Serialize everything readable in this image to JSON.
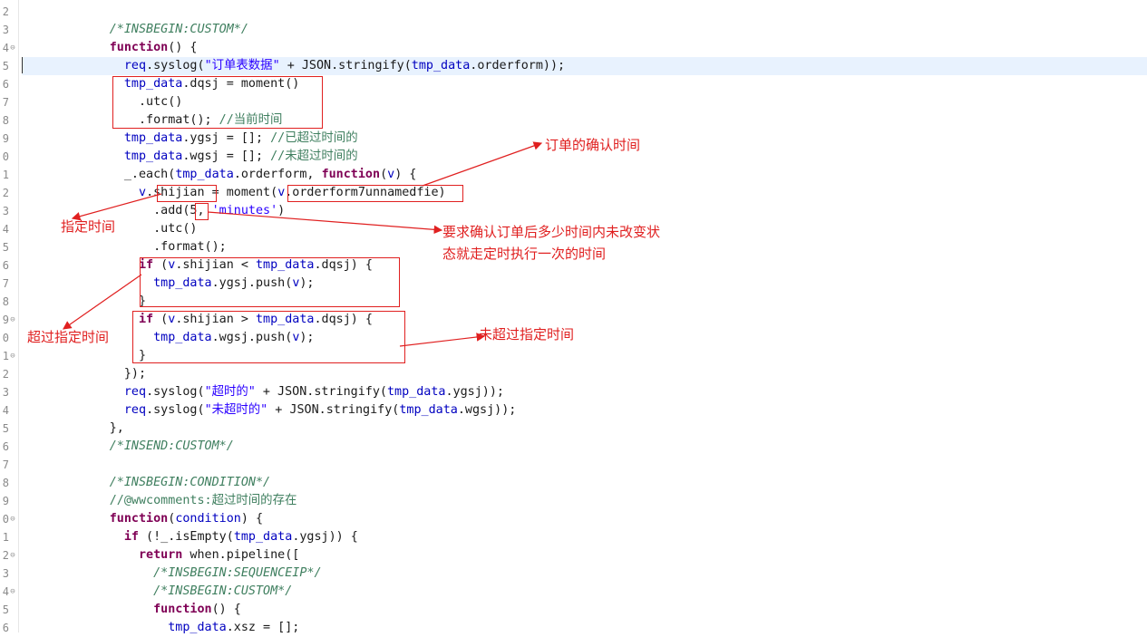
{
  "gutter": {
    "numbers": [
      "2",
      "3",
      "4",
      "5",
      "6",
      "7",
      "8",
      "9",
      "0",
      "1",
      "2",
      "3",
      "4",
      "5",
      "6",
      "7",
      "8",
      "9",
      "0",
      "1",
      "2",
      "3",
      "4",
      "5",
      "6",
      "7",
      "8",
      "9",
      "0",
      "1",
      "2",
      "3",
      "4",
      "5",
      "6"
    ],
    "folds": {
      "2": "⊖",
      "17": "⊖",
      "19": "⊖",
      "28": "⊖",
      "30": "⊖",
      "32": "⊖",
      "35": "⊖"
    }
  },
  "code": {
    "lines": [
      [],
      [
        {
          "t": "            "
        },
        {
          "t": "/*INSBEGIN:CUSTOM*/",
          "c": "cm"
        }
      ],
      [
        {
          "t": "            "
        },
        {
          "t": "function",
          "c": "kw"
        },
        {
          "t": "() {"
        }
      ],
      [
        {
          "t": "              "
        },
        {
          "t": "req",
          "c": "var"
        },
        {
          "t": ".syslog("
        },
        {
          "t": "\"订单表数据\"",
          "c": "str"
        },
        {
          "t": " + JSON.stringify("
        },
        {
          "t": "tmp_data",
          "c": "var"
        },
        {
          "t": ".orderform));"
        }
      ],
      [
        {
          "t": "              "
        },
        {
          "t": "tmp_data",
          "c": "var"
        },
        {
          "t": ".dqsj = moment()"
        }
      ],
      [
        {
          "t": "                .utc()"
        }
      ],
      [
        {
          "t": "                .format(); "
        },
        {
          "t": "//当前时间",
          "c": "cmcn"
        }
      ],
      [
        {
          "t": "              "
        },
        {
          "t": "tmp_data",
          "c": "var"
        },
        {
          "t": ".ygsj = []; "
        },
        {
          "t": "//已超过时间的",
          "c": "cmcn"
        }
      ],
      [
        {
          "t": "              "
        },
        {
          "t": "tmp_data",
          "c": "var"
        },
        {
          "t": ".wgsj = []; "
        },
        {
          "t": "//未超过时间的",
          "c": "cmcn"
        }
      ],
      [
        {
          "t": "              _.each("
        },
        {
          "t": "tmp_data",
          "c": "var"
        },
        {
          "t": ".orderform, "
        },
        {
          "t": "function",
          "c": "kw"
        },
        {
          "t": "("
        },
        {
          "t": "v",
          "c": "var"
        },
        {
          "t": ") {"
        }
      ],
      [
        {
          "t": "                "
        },
        {
          "t": "v",
          "c": "var"
        },
        {
          "t": ".shijian = moment("
        },
        {
          "t": "v",
          "c": "var"
        },
        {
          "t": ".orderform7unnamedfie)"
        }
      ],
      [
        {
          "t": "                  .add(5, "
        },
        {
          "t": "'minutes'",
          "c": "str"
        },
        {
          "t": ")"
        }
      ],
      [
        {
          "t": "                  .utc()"
        }
      ],
      [
        {
          "t": "                  .format();"
        }
      ],
      [
        {
          "t": "                "
        },
        {
          "t": "if",
          "c": "kw"
        },
        {
          "t": " ("
        },
        {
          "t": "v",
          "c": "var"
        },
        {
          "t": ".shijian < "
        },
        {
          "t": "tmp_data",
          "c": "var"
        },
        {
          "t": ".dqsj) {"
        }
      ],
      [
        {
          "t": "                  "
        },
        {
          "t": "tmp_data",
          "c": "var"
        },
        {
          "t": ".ygsj.push("
        },
        {
          "t": "v",
          "c": "var"
        },
        {
          "t": ");"
        }
      ],
      [
        {
          "t": "                }"
        }
      ],
      [
        {
          "t": "                "
        },
        {
          "t": "if",
          "c": "kw"
        },
        {
          "t": " ("
        },
        {
          "t": "v",
          "c": "var"
        },
        {
          "t": ".shijian > "
        },
        {
          "t": "tmp_data",
          "c": "var"
        },
        {
          "t": ".dqsj) {"
        }
      ],
      [
        {
          "t": "                  "
        },
        {
          "t": "tmp_data",
          "c": "var"
        },
        {
          "t": ".wgsj.push("
        },
        {
          "t": "v",
          "c": "var"
        },
        {
          "t": ");"
        }
      ],
      [
        {
          "t": "                }"
        }
      ],
      [
        {
          "t": "              });"
        }
      ],
      [
        {
          "t": "              "
        },
        {
          "t": "req",
          "c": "var"
        },
        {
          "t": ".syslog("
        },
        {
          "t": "\"超时的\"",
          "c": "str"
        },
        {
          "t": " + JSON.stringify("
        },
        {
          "t": "tmp_data",
          "c": "var"
        },
        {
          "t": ".ygsj));"
        }
      ],
      [
        {
          "t": "              "
        },
        {
          "t": "req",
          "c": "var"
        },
        {
          "t": ".syslog("
        },
        {
          "t": "\"未超时的\"",
          "c": "str"
        },
        {
          "t": " + JSON.stringify("
        },
        {
          "t": "tmp_data",
          "c": "var"
        },
        {
          "t": ".wgsj));"
        }
      ],
      [
        {
          "t": "            },"
        }
      ],
      [
        {
          "t": "            "
        },
        {
          "t": "/*INSEND:CUSTOM*/",
          "c": "cm"
        }
      ],
      [],
      [
        {
          "t": "            "
        },
        {
          "t": "/*INSBEGIN:CONDITION*/",
          "c": "cm"
        }
      ],
      [
        {
          "t": "            "
        },
        {
          "t": "//@wwcomments:超过时间的存在",
          "c": "cmcn"
        }
      ],
      [
        {
          "t": "            "
        },
        {
          "t": "function",
          "c": "kw"
        },
        {
          "t": "("
        },
        {
          "t": "condition",
          "c": "var"
        },
        {
          "t": ") {"
        }
      ],
      [
        {
          "t": "              "
        },
        {
          "t": "if",
          "c": "kw"
        },
        {
          "t": " (!_.isEmpty("
        },
        {
          "t": "tmp_data",
          "c": "var"
        },
        {
          "t": ".ygsj)) {"
        }
      ],
      [
        {
          "t": "                "
        },
        {
          "t": "return",
          "c": "kw"
        },
        {
          "t": " when.pipeline(["
        }
      ],
      [
        {
          "t": "                  "
        },
        {
          "t": "/*INSBEGIN:SEQUENCEIP*/",
          "c": "cm"
        }
      ],
      [
        {
          "t": "                  "
        },
        {
          "t": "/*INSBEGIN:CUSTOM*/",
          "c": "cm"
        }
      ],
      [
        {
          "t": "                  "
        },
        {
          "t": "function",
          "c": "kw"
        },
        {
          "t": "() {"
        }
      ],
      [
        {
          "t": "                    "
        },
        {
          "t": "tmp_data",
          "c": "var"
        },
        {
          "t": ".xsz = [];"
        }
      ]
    ]
  },
  "annotations": {
    "confirm_time": "订单的确认时间",
    "specified_time": "指定时间",
    "duration_line1": "要求确认订单后多少时间内未改变状",
    "duration_line2": "态就走定时执行一次的时间",
    "exceeded": "超过指定时间",
    "not_exceeded": "未超过指定时间"
  },
  "colors": {
    "annotation": "#e02020",
    "keyword": "#7f0055",
    "variable": "#0000c0",
    "string": "#2a00ff",
    "comment": "#3f7f5f",
    "current_line": "#e8f2fe"
  }
}
